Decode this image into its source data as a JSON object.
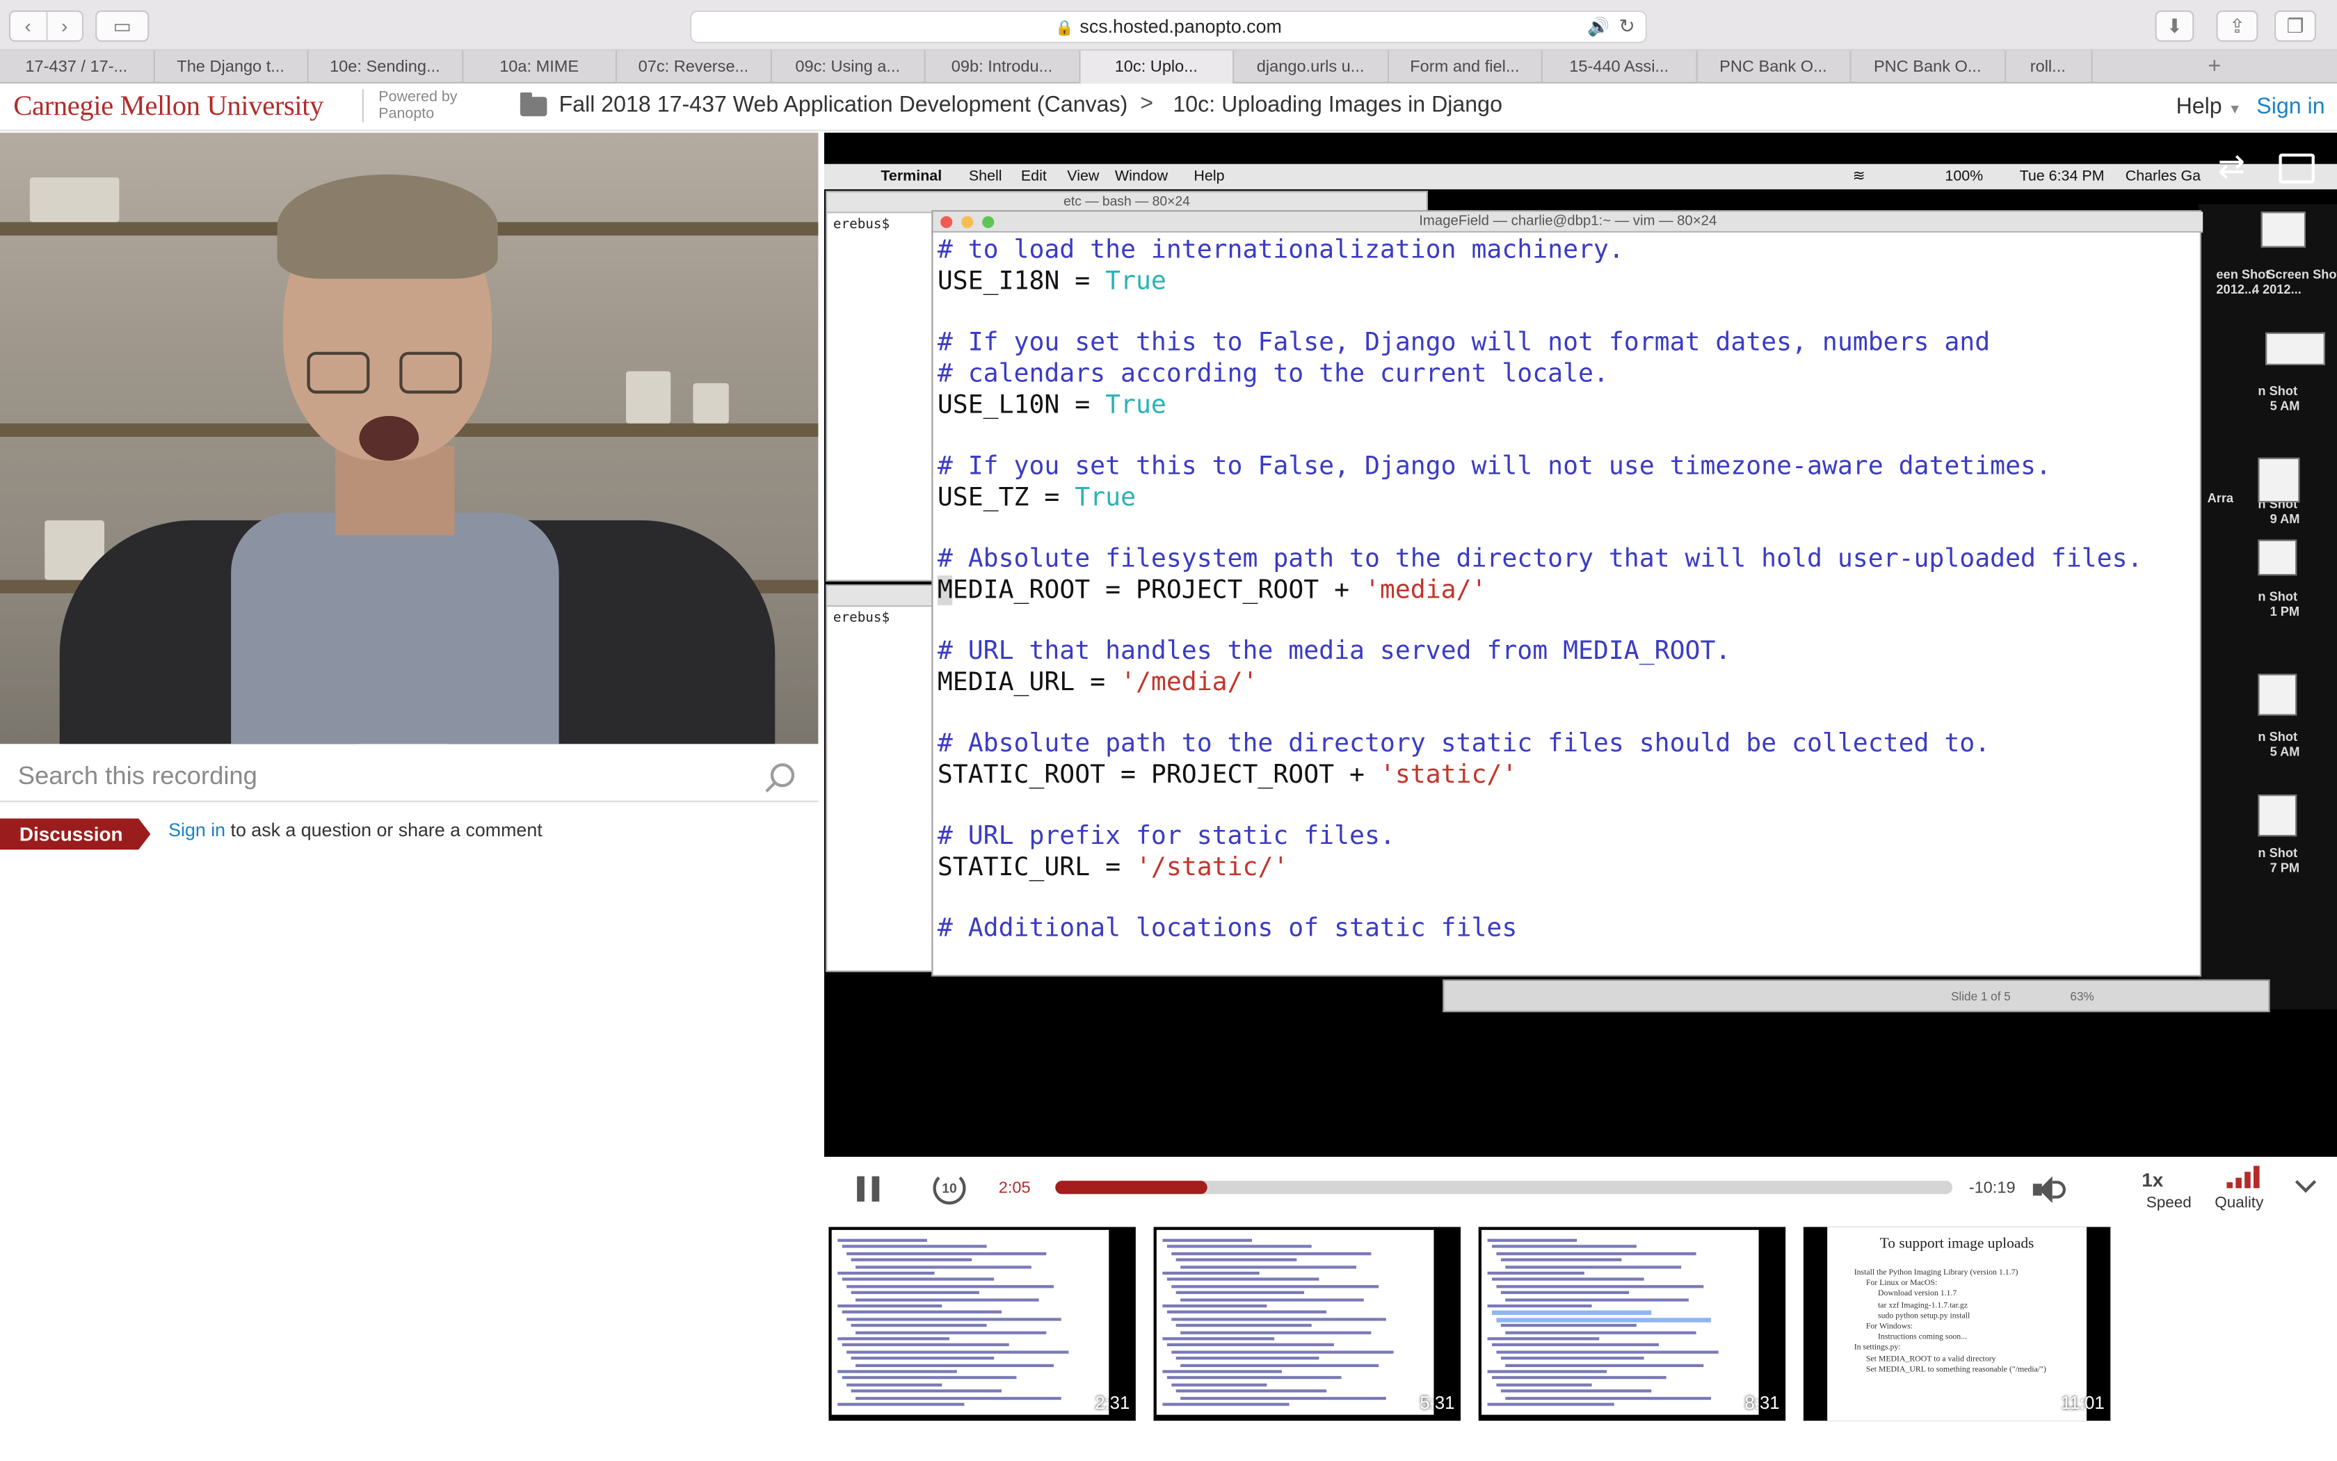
{
  "browser": {
    "url": "scs.hosted.panopto.com",
    "tabs": [
      "17-437 / 17-...",
      "The Django t...",
      "10e: Sending...",
      "10a: MIME",
      "07c: Reverse...",
      "09c: Using a...",
      "09b: Introdu...",
      "10c: Uplo...",
      "django.urls u...",
      "Form and fiel...",
      "15-440 Assi...",
      "PNC Bank O...",
      "PNC Bank O...",
      "roll..."
    ],
    "active_tab_index": 7
  },
  "header": {
    "org": "Carnegie Mellon University",
    "powered_1": "Powered by",
    "powered_2": "Panopto",
    "folder": "Fall 2018 17-437 Web Application Development (Canvas)",
    "separator": ">",
    "session": "10c: Uploading Images in Django",
    "help": "Help",
    "signin": "Sign in"
  },
  "sidebar": {
    "search_placeholder": "Search this recording",
    "discussion_tab": "Discussion",
    "signin_link": "Sign in",
    "signin_suffix": " to ask a question or share a comment"
  },
  "video": {
    "menubar": {
      "app": "Terminal",
      "items": [
        "Shell",
        "Edit",
        "View",
        "Window",
        "Help"
      ],
      "battery": "100%",
      "clock": "Tue 6:34 PM",
      "user": "Charles Ga"
    },
    "term1_title": "etc — bash — 80×24",
    "term1_prompt": "erebus$ ",
    "term2_prompt": "erebus$ ",
    "vim_title": "ImageField — charlie@dbp1:~ — vim — 80×24",
    "code_lines": [
      {
        "t": "c",
        "text": "# to load the internationalization machinery."
      },
      {
        "t": "kv",
        "k": "USE_I18N = ",
        "v": "True"
      },
      {
        "t": "blank",
        "text": ""
      },
      {
        "t": "c",
        "text": "# If you set this to False, Django will not format dates, numbers and"
      },
      {
        "t": "c",
        "text": "# calendars according to the current locale."
      },
      {
        "t": "kv",
        "k": "USE_L10N = ",
        "v": "True"
      },
      {
        "t": "blank",
        "text": ""
      },
      {
        "t": "c",
        "text": "# If you set this to False, Django will not use timezone-aware datetimes."
      },
      {
        "t": "kv",
        "k": "USE_TZ = ",
        "v": "True"
      },
      {
        "t": "blank",
        "text": ""
      },
      {
        "t": "c",
        "text": "# Absolute filesystem path to the directory that will hold user-uploaded files."
      },
      {
        "t": "ks",
        "k": "MEDIA_ROOT = PROJECT_ROOT + ",
        "v": "'media/'",
        "cursor": true
      },
      {
        "t": "blank",
        "text": ""
      },
      {
        "t": "c",
        "text": "# URL that handles the media served from MEDIA_ROOT."
      },
      {
        "t": "ks",
        "k": "MEDIA_URL = ",
        "v": "'/media/'"
      },
      {
        "t": "blank",
        "text": ""
      },
      {
        "t": "c",
        "text": "# Absolute path to the directory static files should be collected to."
      },
      {
        "t": "ks",
        "k": "STATIC_ROOT = PROJECT_ROOT + ",
        "v": "'static/'"
      },
      {
        "t": "blank",
        "text": ""
      },
      {
        "t": "c",
        "text": "# URL prefix for static files."
      },
      {
        "t": "ks",
        "k": "STATIC_URL = ",
        "v": "'/static/'"
      },
      {
        "t": "blank",
        "text": ""
      },
      {
        "t": "c",
        "text": "# Additional locations of static files"
      }
    ],
    "right_labels": [
      "een Shot",
      "2012...",
      "Screen Shot",
      "4 2012...",
      "n Shot",
      "5 AM",
      "n Shot",
      "9 AM",
      "n Shot",
      "1 PM",
      "n Shot",
      "5 AM",
      "n Shot",
      "7 PM",
      "Arra"
    ],
    "keynote_slide": "Slide 1 of 5",
    "keynote_zoom": "63%"
  },
  "player": {
    "rewind_label": "10",
    "elapsed": "2:05",
    "remaining": "-10:19",
    "progress": 0.17,
    "speed": "1x",
    "speed_label": "Speed",
    "quality_label": "Quality"
  },
  "thumbnails": [
    {
      "stamp": "2:31"
    },
    {
      "stamp": "5:31"
    },
    {
      "stamp": "8:31"
    },
    {
      "stamp": "11:01",
      "slide_title": "To support image uploads",
      "bullets": [
        "Install the Python Imaging Library (version 1.1.7)",
        "For Linux or MacOS:",
        "Download version 1.1.7",
        "tar xzf Imaging-1.1.7.tar.gz",
        "sudo python setup.py install",
        "For Windows:",
        "Instructions coming soon...",
        "In settings.py:",
        "Set MEDIA_ROOT to a valid directory",
        "Set MEDIA_URL to something reasonable (\"/media/\")"
      ]
    }
  ]
}
